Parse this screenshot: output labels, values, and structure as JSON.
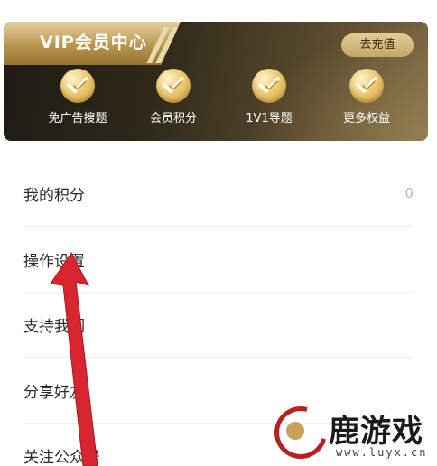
{
  "vip": {
    "title": "VIP会员中心",
    "recharge_label": "去充值",
    "benefits": [
      {
        "label": "免广告搜题",
        "icon": "gold-check-badge-icon"
      },
      {
        "label": "会员积分",
        "icon": "gold-check-badge-icon"
      },
      {
        "label": "1V1导题",
        "icon": "gold-check-badge-icon"
      },
      {
        "label": "更多权益",
        "icon": "gold-check-badge-icon"
      }
    ]
  },
  "menu": [
    {
      "label": "我的积分",
      "value": "0"
    },
    {
      "label": "操作设置"
    },
    {
      "label": "支持我们"
    },
    {
      "label": "分享好友"
    },
    {
      "label": "关注公众号"
    }
  ],
  "watermark": {
    "brand": "鹿游戏",
    "url": "www.luyx.cn"
  },
  "colors": {
    "card_dark": "#1f1b14",
    "gold": "#c8a25a",
    "arrow_red": "#d7262f"
  }
}
